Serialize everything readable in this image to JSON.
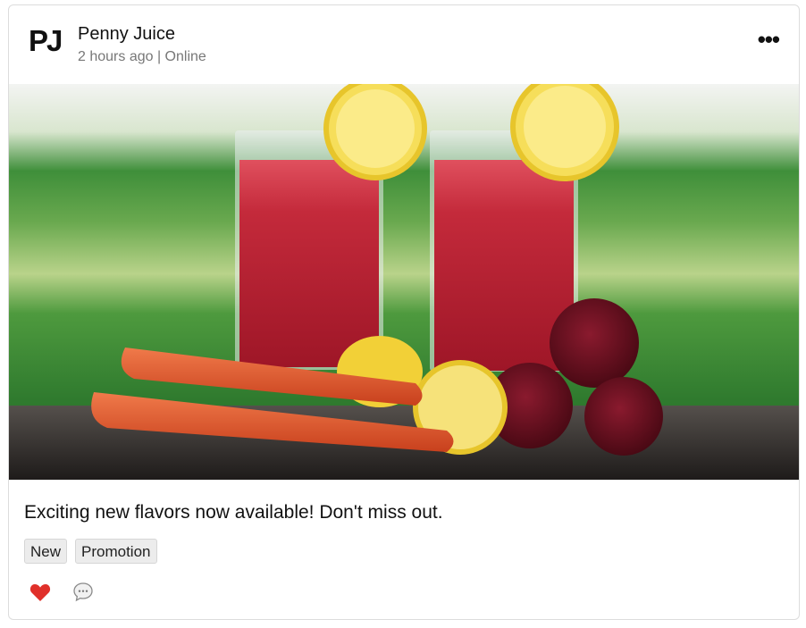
{
  "post": {
    "logo_text": "PJ",
    "author": "Penny Juice",
    "meta": "2 hours ago | Online",
    "caption": "Exciting new flavors now available! Don't miss out.",
    "tags": [
      "New",
      "Promotion"
    ]
  },
  "icons": {
    "more": "more-options-icon",
    "like": "heart-icon",
    "comment": "comment-icon"
  },
  "colors": {
    "heart": "#e0302a",
    "juice": "#b51f30",
    "carrot": "#e8552d",
    "lemon": "#f3d23a",
    "beet": "#6e0f1f",
    "grass": "#3f8f3a"
  }
}
